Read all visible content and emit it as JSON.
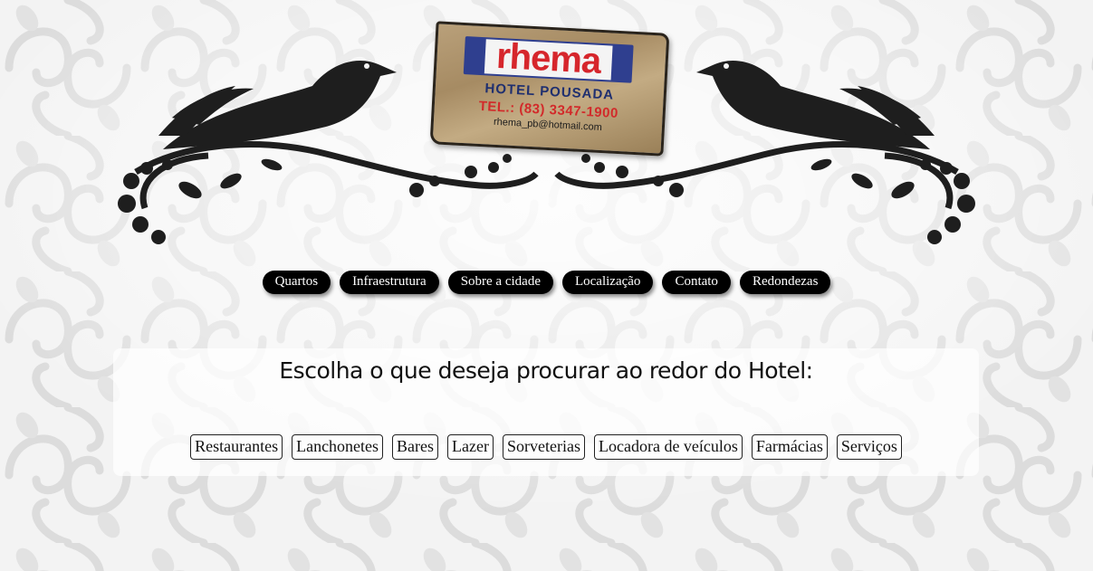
{
  "logo": {
    "brand": "rhema",
    "line1": "HOTEL POUSADA",
    "line2": "TEL.: (83) 3347-1900",
    "line3": "rhema_pb@hotmail.com"
  },
  "nav": {
    "items": [
      "Quartos",
      "Infraestrutura",
      "Sobre a cidade",
      "Localização",
      "Contato",
      "Redondezas"
    ]
  },
  "search": {
    "title": "Escolha o que deseja procurar ao redor do Hotel:",
    "categories": [
      "Restaurantes",
      "Lanchonetes",
      "Bares",
      "Lazer",
      "Sorveterias",
      "Locadora de veículos",
      "Farmácias",
      "Serviços"
    ]
  },
  "colors": {
    "nav_bg": "#000000",
    "brand_blue": "#2f3f8f",
    "brand_red": "#d6262c"
  }
}
